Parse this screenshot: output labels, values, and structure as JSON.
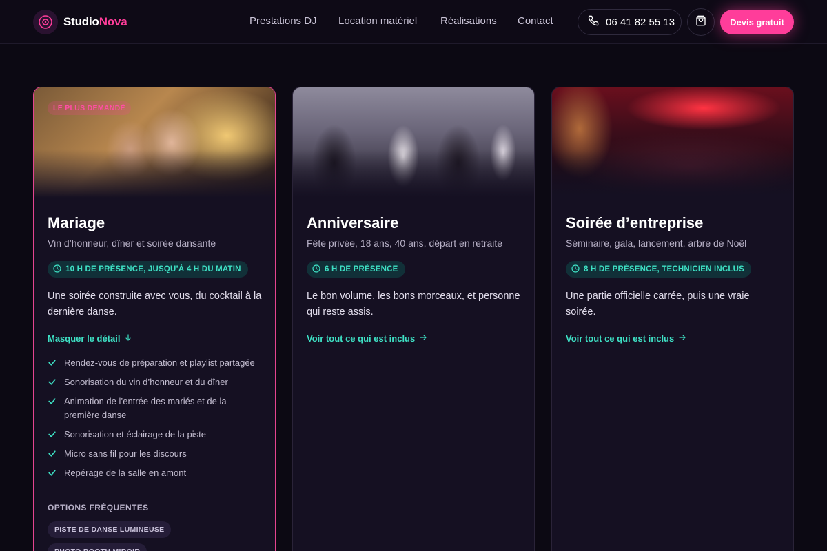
{
  "header": {
    "brand_first": "Studio",
    "brand_second": "Nova",
    "nav": [
      "Prestations DJ",
      "Location matériel",
      "Réalisations",
      "Contact"
    ],
    "phone": "06 41 82 55 13",
    "cta": "Devis gratuit"
  },
  "colors": {
    "accent": "#ff3d9a",
    "teal": "#3ee0c4",
    "background": "#0c0913",
    "card": "#151022"
  },
  "cards": [
    {
      "badge": "LE PLUS DEMANDÉ",
      "title": "Mariage",
      "subtitle": "Vin d’honneur, dîner et soirée dansante",
      "duration": "10 H DE PRÉSENCE, JUSQU’À 4 H DU MATIN",
      "description": "Une soirée construite avec vous, du cocktail à la dernière danse.",
      "link": "Masquer le détail",
      "link_icon": "arrow-down-icon",
      "features": [
        "Rendez-vous de préparation et playlist partagée",
        "Sonorisation du vin d’honneur et du dîner",
        "Animation de l’entrée des mariés et de la première danse",
        "Sonorisation et éclairage de la piste",
        "Micro sans fil pour les discours",
        "Repérage de la salle en amont"
      ],
      "options_title": "OPTIONS FRÉQUENTES",
      "options": [
        "PISTE DE DANSE LUMINEUSE",
        "PHOTO BOOTH MIROIR"
      ]
    },
    {
      "title": "Anniversaire",
      "subtitle": "Fête privée, 18 ans, 40 ans, départ en retraite",
      "duration": "6 H DE PRÉSENCE",
      "description": "Le bon volume, les bons morceaux, et personne qui reste assis.",
      "link": "Voir tout ce qui est inclus",
      "link_icon": "arrow-right-icon"
    },
    {
      "title": "Soirée d’entreprise",
      "subtitle": "Séminaire, gala, lancement, arbre de Noël",
      "duration": "8 H DE PRÉSENCE, TECHNICIEN INCLUS",
      "description": "Une partie officielle carrée, puis une vraie soirée.",
      "link": "Voir tout ce qui est inclus",
      "link_icon": "arrow-right-icon"
    }
  ]
}
